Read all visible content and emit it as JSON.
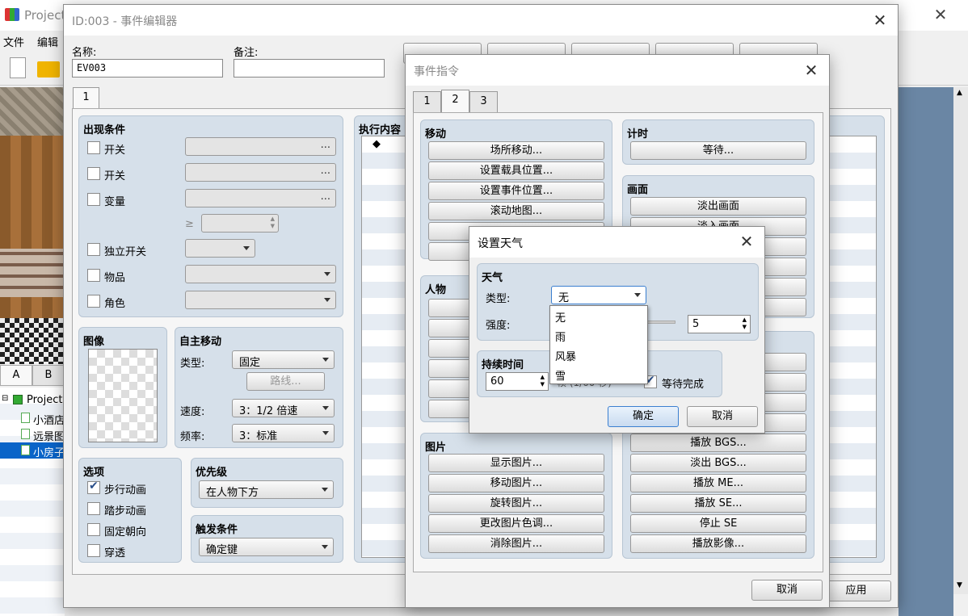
{
  "app": {
    "title": "Project",
    "menu": [
      "文件",
      "编辑"
    ],
    "palette_tabs": [
      "A",
      "B"
    ],
    "tree": {
      "root": "Project",
      "items": [
        "小酒店",
        "远景图",
        "小房子"
      ]
    }
  },
  "event_editor": {
    "title": "ID:003 - 事件编辑器",
    "name_label": "名称:",
    "name_value": "EV003",
    "note_label": "备注:",
    "note_value": "",
    "page_tab": "1",
    "conditions": {
      "title": "出现条件",
      "switch1": "开关",
      "switch2": "开关",
      "variable": "变量",
      "gte": "≥",
      "self_switch": "独立开关",
      "item": "物品",
      "actor": "角色",
      "dots": "..."
    },
    "image": {
      "title": "图像"
    },
    "autonomous": {
      "title": "自主移动",
      "type_label": "类型:",
      "type_value": "固定",
      "route_button": "路线...",
      "speed_label": "速度:",
      "speed_value": "3：1/2 倍速",
      "freq_label": "频率:",
      "freq_value": "3：标准"
    },
    "options": {
      "title": "选项",
      "walking": "步行动画",
      "stepping": "踏步动画",
      "direction_fix": "固定朝向",
      "through": "穿透",
      "walking_checked": true
    },
    "priority": {
      "title": "优先级",
      "value": "在人物下方"
    },
    "trigger": {
      "title": "触发条件",
      "value": "确定键"
    },
    "contents": {
      "title": "执行内容",
      "first_line": "◆"
    },
    "apply_button": "应用"
  },
  "event_commands": {
    "title": "事件指令",
    "tabs": [
      "1",
      "2",
      "3"
    ],
    "active_tab": "2",
    "movement": {
      "title": "移动",
      "buttons": [
        "场所移动...",
        "设置载具位置...",
        "设置事件位置...",
        "滚动地图..."
      ]
    },
    "character": {
      "title": "人物"
    },
    "picture": {
      "title": "图片",
      "buttons": [
        "显示图片...",
        "移动图片...",
        "旋转图片...",
        "更改图片色调...",
        "消除图片..."
      ]
    },
    "timing": {
      "title": "计时",
      "buttons": [
        "等待..."
      ]
    },
    "screen": {
      "title": "画面",
      "buttons": [
        "淡出画面",
        "淡入画面"
      ]
    },
    "audio": {
      "buttons": [
        "播放 BGS...",
        "淡出 BGS...",
        "播放 ME...",
        "播放 SE...",
        "停止 SE",
        "播放影像..."
      ]
    },
    "cancel_button": "取消"
  },
  "weather_dialog": {
    "title": "设置天气",
    "weather_group": "天气",
    "type_label": "类型:",
    "type_value": "无",
    "options": [
      "无",
      "雨",
      "风暴",
      "雪"
    ],
    "power_label": "强度:",
    "power_value": "5",
    "duration_group": "持续时间",
    "duration_value": "60",
    "duration_unit": "帧 (1/60 秒)",
    "wait_label": "等待完成",
    "wait_checked": true,
    "ok_button": "确定",
    "cancel_button": "取消"
  }
}
